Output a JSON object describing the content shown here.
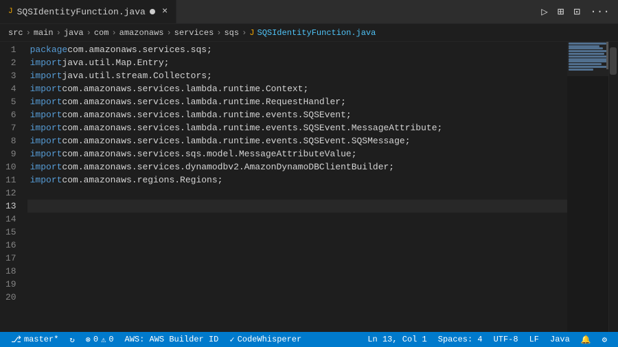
{
  "tab": {
    "filename": "SQSIdentityFunction.java",
    "modified": true,
    "close_label": "×",
    "java_icon": "J"
  },
  "breadcrumb": {
    "items": [
      "src",
      "main",
      "java",
      "com",
      "amazonaws",
      "services",
      "sqs"
    ],
    "file_icon": "J",
    "filename": "SQSIdentityFunction.java",
    "separators": [
      ">",
      ">",
      ">",
      ">",
      ">",
      ">",
      ">",
      ">"
    ]
  },
  "toolbar": {
    "run_icon": "▷",
    "split_icon": "⊞",
    "layout_icon": "⊡",
    "more_icon": "···"
  },
  "code_lines": [
    {
      "num": 1,
      "tokens": [
        {
          "cls": "kw",
          "t": "package"
        },
        {
          "cls": "plain",
          "t": " com.amazonaws.services.sqs;"
        }
      ]
    },
    {
      "num": 2,
      "tokens": [
        {
          "cls": "kw",
          "t": "import"
        },
        {
          "cls": "plain",
          "t": " java.util.Map.Entry;"
        }
      ]
    },
    {
      "num": 3,
      "tokens": [
        {
          "cls": "kw",
          "t": "import"
        },
        {
          "cls": "plain",
          "t": " java.util.stream.Collectors;"
        }
      ]
    },
    {
      "num": 4,
      "tokens": [
        {
          "cls": "kw",
          "t": "import"
        },
        {
          "cls": "plain",
          "t": " com.amazonaws.services.lambda.runtime.Context;"
        }
      ]
    },
    {
      "num": 5,
      "tokens": [
        {
          "cls": "kw",
          "t": "import"
        },
        {
          "cls": "plain",
          "t": " com.amazonaws.services.lambda.runtime.RequestHandler;"
        }
      ]
    },
    {
      "num": 6,
      "tokens": [
        {
          "cls": "kw",
          "t": "import"
        },
        {
          "cls": "plain",
          "t": " com.amazonaws.services.lambda.runtime.events.SQSEvent;"
        }
      ]
    },
    {
      "num": 7,
      "tokens": [
        {
          "cls": "kw",
          "t": "import"
        },
        {
          "cls": "plain",
          "t": " com.amazonaws.services.lambda.runtime.events.SQSEvent.MessageAttribute;"
        }
      ]
    },
    {
      "num": 8,
      "tokens": [
        {
          "cls": "kw",
          "t": "import"
        },
        {
          "cls": "plain",
          "t": " com.amazonaws.services.lambda.runtime.events.SQSEvent.SQSMessage;"
        }
      ]
    },
    {
      "num": 9,
      "tokens": [
        {
          "cls": "kw",
          "t": "import"
        },
        {
          "cls": "plain",
          "t": " com.amazonaws.services.sqs.model.MessageAttributeValue;"
        }
      ]
    },
    {
      "num": 10,
      "tokens": [
        {
          "cls": "kw",
          "t": "import"
        },
        {
          "cls": "plain",
          "t": " com.amazonaws.services.dynamodbv2.AmazonDynamoDBClientBuilder;"
        }
      ]
    },
    {
      "num": 11,
      "tokens": [
        {
          "cls": "kw",
          "t": "import"
        },
        {
          "cls": "plain",
          "t": " com.amazonaws.regions.Regions;"
        }
      ]
    },
    {
      "num": 12,
      "tokens": []
    },
    {
      "num": 13,
      "tokens": [],
      "active": true
    },
    {
      "num": 14,
      "tokens": []
    },
    {
      "num": 15,
      "tokens": []
    },
    {
      "num": 16,
      "tokens": []
    },
    {
      "num": 17,
      "tokens": []
    },
    {
      "num": 18,
      "tokens": []
    },
    {
      "num": 19,
      "tokens": []
    },
    {
      "num": 20,
      "tokens": []
    }
  ],
  "status_bar": {
    "branch_icon": "⎇",
    "branch": "master*",
    "sync_icon": "↻",
    "error_icon": "⊗",
    "errors": "0",
    "warning_icon": "⚠",
    "warnings": "0",
    "aws_label": "AWS: AWS Builder ID",
    "codewhisperer_icon": "✓",
    "codewhisperer": "CodeWhisperer",
    "position": "Ln 13, Col 1",
    "spaces": "Spaces: 4",
    "encoding": "UTF-8",
    "line_ending": "LF",
    "language": "Java",
    "feedback_icon": "🔔",
    "settings_icon": "⚙"
  }
}
